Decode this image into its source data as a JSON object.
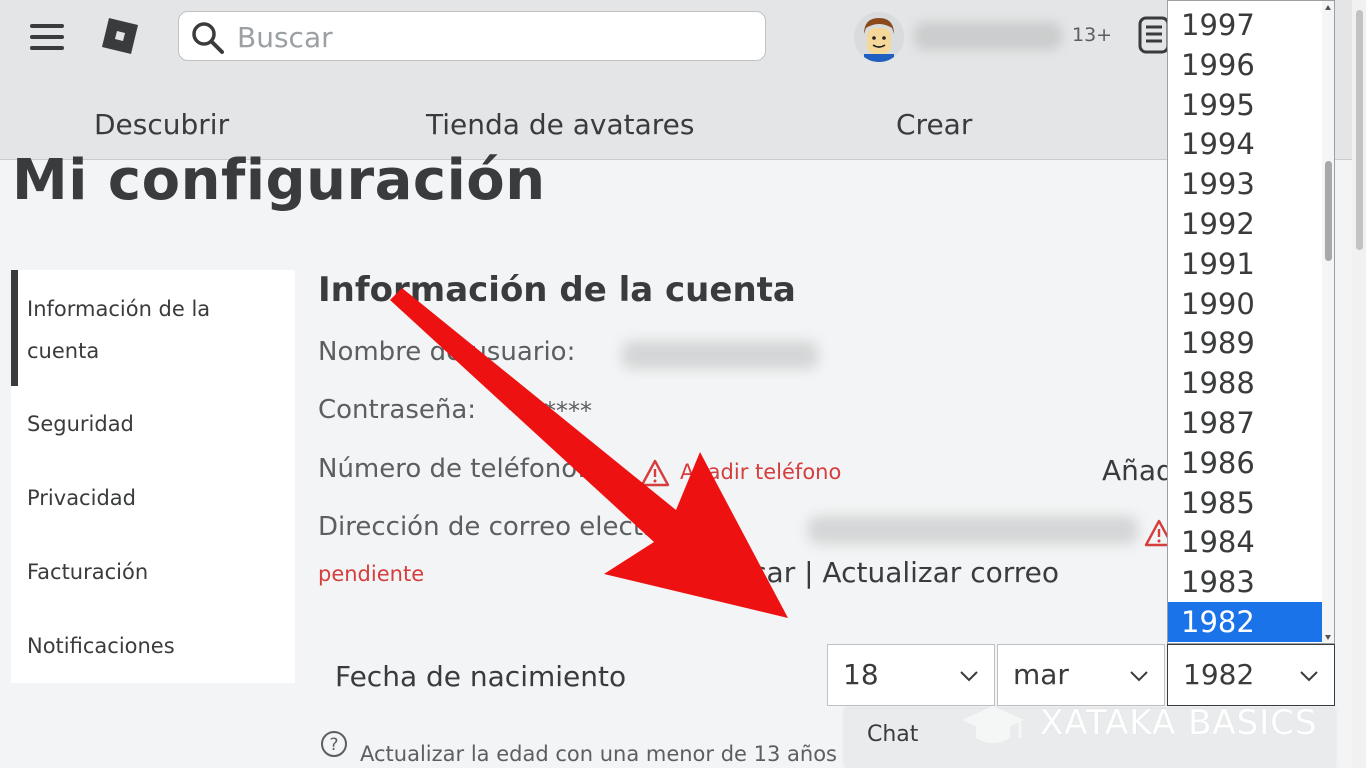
{
  "header": {
    "search_placeholder": "Buscar",
    "age_badge": "13+",
    "nav_tabs": [
      "Descubrir",
      "Tienda de avatares",
      "Crear"
    ]
  },
  "page": {
    "title": "Mi configuración"
  },
  "sidebar": {
    "items": [
      {
        "label": "Información de la cuenta",
        "active": true
      },
      {
        "label": "Seguridad"
      },
      {
        "label": "Privacidad"
      },
      {
        "label": "Facturación"
      },
      {
        "label": "Notificaciones"
      }
    ]
  },
  "account": {
    "section_title": "Información de la cuenta",
    "username_label": "Nombre de usuario:",
    "password_label": "Contraseña:",
    "password_value": "*******",
    "phone_label": "Número de teléfono:",
    "phone_add_link": "Añadir teléfono",
    "phone_add_action": "Añadir",
    "email_label": "Dirección de correo electrónico:",
    "email_status": "pendiente",
    "email_actions": "Verificar | Actualizar correo",
    "birthdate_label": "Fecha de nacimiento",
    "birth_day": "18",
    "birth_month": "mar",
    "birth_year": "1982",
    "help_text": "Actualizar la edad con una menor de 13 años"
  },
  "year_dropdown": {
    "options": [
      "1997",
      "1996",
      "1995",
      "1994",
      "1993",
      "1992",
      "1991",
      "1990",
      "1989",
      "1988",
      "1987",
      "1986",
      "1985",
      "1984",
      "1983",
      "1982"
    ],
    "selected": "1982"
  },
  "chat": {
    "label": "Chat"
  },
  "watermark": {
    "text": "XATAKA BASICS"
  },
  "colors": {
    "header_bg": "#e3e5e6",
    "page_bg": "#f2f4f5",
    "warning_red": "#d63d3d",
    "selected_blue": "#1a73e8",
    "annotation_arrow": "#ee1111"
  }
}
